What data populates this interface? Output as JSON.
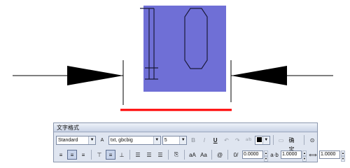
{
  "canvas": {
    "dimension_text": "10",
    "colors": {
      "highlight": "#6f6fd6",
      "underline": "#ff0000",
      "line": "#000000"
    }
  },
  "panel": {
    "title": "文字格式",
    "style_select": "Standard",
    "font_select": "txt, gbcbig",
    "height_select": "5",
    "bold_label": "B",
    "italic_label": "I",
    "underline_label": "U",
    "undo_label": "↶",
    "redo_label": "↷",
    "stack_label": "a/b",
    "ok_label": "确定",
    "oblique_value": "0.0000",
    "tracking_value": "1.0000",
    "width_value": "1.0000",
    "color_swatch": "#000000"
  }
}
